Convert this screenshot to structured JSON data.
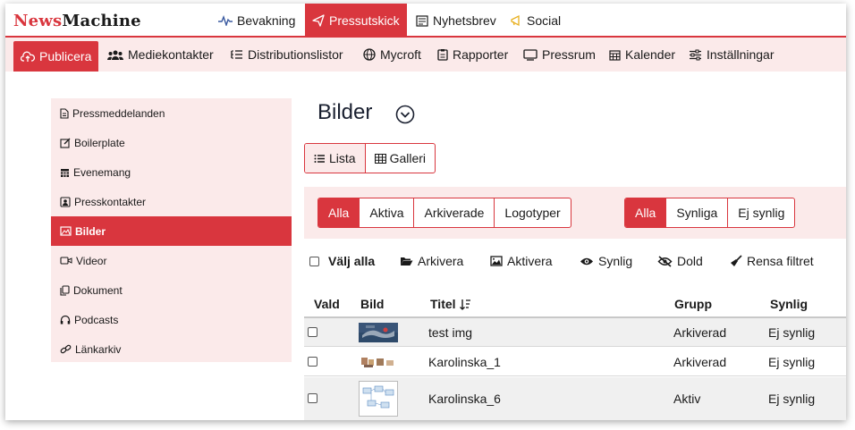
{
  "brand": {
    "part1": "News",
    "part2": "Machine"
  },
  "topnav": [
    {
      "label": "Bevakning",
      "icon": "pulse-icon"
    },
    {
      "label": "Pressutskick",
      "icon": "paper-plane-icon",
      "active": true
    },
    {
      "label": "Nyhetsbrev",
      "icon": "newspaper-icon"
    },
    {
      "label": "Social",
      "icon": "megaphone-icon"
    }
  ],
  "subnav": [
    {
      "label": "Publicera",
      "icon": "cloud-upload-icon",
      "active": true
    },
    {
      "label": "Mediekontakter",
      "icon": "people-icon"
    },
    {
      "label": "Distributionslistor",
      "icon": "list-icon"
    },
    {
      "label": "Mycroft",
      "icon": "globe-icon"
    },
    {
      "label": "Rapporter",
      "icon": "clipboard-icon"
    },
    {
      "label": "Pressrum",
      "icon": "monitor-icon"
    },
    {
      "label": "Kalender",
      "icon": "calendar-icon"
    },
    {
      "label": "Inställningar",
      "icon": "sliders-icon"
    }
  ],
  "sidebar": [
    {
      "label": "Pressmeddelanden",
      "icon": "document-icon"
    },
    {
      "label": "Boilerplate",
      "icon": "edit-icon"
    },
    {
      "label": "Evenemang",
      "icon": "calendar-icon"
    },
    {
      "label": "Presskontakter",
      "icon": "contact-card-icon"
    },
    {
      "label": "Bilder",
      "icon": "image-icon",
      "active": true
    },
    {
      "label": "Videor",
      "icon": "video-camera-icon"
    },
    {
      "label": "Dokument",
      "icon": "files-icon"
    },
    {
      "label": "Podcasts",
      "icon": "headphones-icon"
    },
    {
      "label": "Länkarkiv",
      "icon": "link-icon"
    }
  ],
  "page": {
    "title": "Bilder"
  },
  "view": {
    "list": "Lista",
    "gallery": "Galleri"
  },
  "filters_status": [
    "Alla",
    "Aktiva",
    "Arkiverade",
    "Logotyper"
  ],
  "filters_visibility": [
    "Alla",
    "Synliga",
    "Ej synlig"
  ],
  "actions": {
    "select_all": "Välj alla",
    "archive": "Arkivera",
    "activate": "Aktivera",
    "visible": "Synlig",
    "hidden": "Dold",
    "clear": "Rensa filtret"
  },
  "table": {
    "headers": {
      "selected": "Vald",
      "image": "Bild",
      "title": "Titel",
      "group": "Grupp",
      "visible": "Synlig"
    },
    "rows": [
      {
        "title": "test img",
        "group": "Arkiverad",
        "visible": "Ej synlig",
        "thumb": "photo-icon"
      },
      {
        "title": "Karolinska_1",
        "group": "Arkiverad",
        "visible": "Ej synlig",
        "thumb": "photo-icon"
      },
      {
        "title": "Karolinska_6",
        "group": "Aktiv",
        "visible": "Ej synlig",
        "thumb": "photo-icon"
      }
    ]
  },
  "colors": {
    "accent": "#d9363e",
    "tint": "#fbeaea"
  }
}
